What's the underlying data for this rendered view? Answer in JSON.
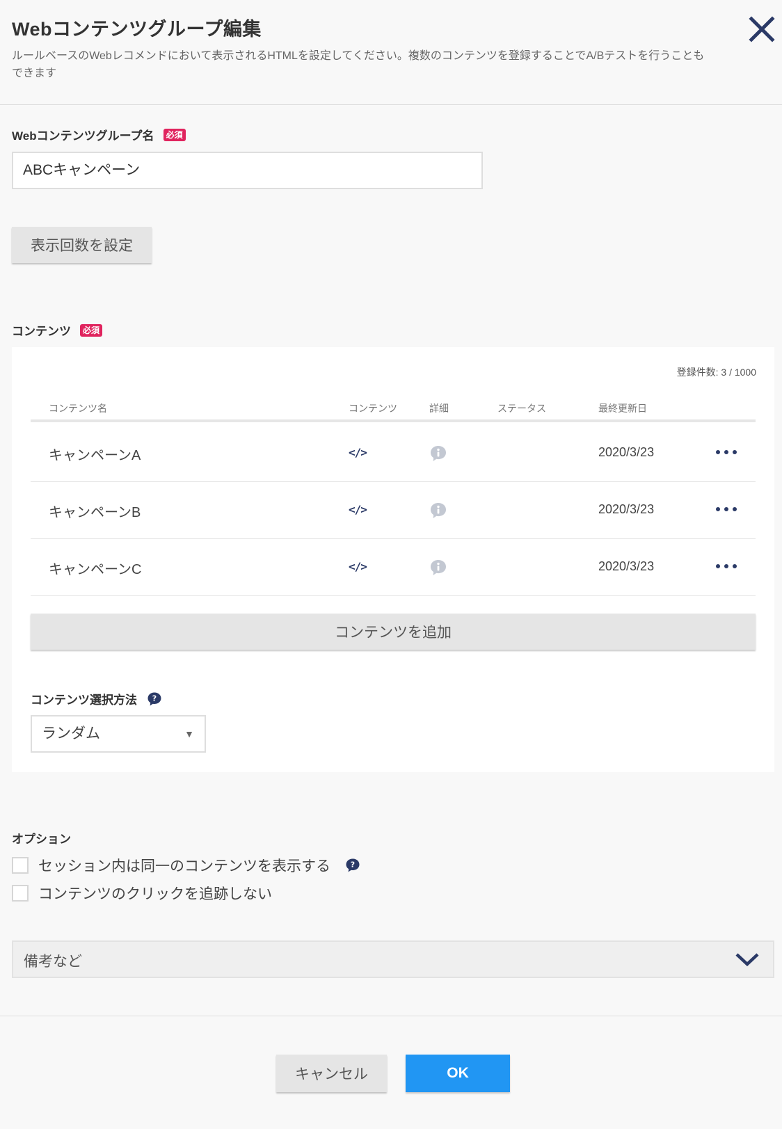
{
  "dialog": {
    "title": "Webコンテンツグループ編集",
    "description": "ルールベースのWebレコメンドにおいて表示されるHTMLを設定してください。複数のコンテンツを登録することでA/Bテストを行うこともできます",
    "close_icon": "close-icon"
  },
  "group_name": {
    "label": "Webコンテンツグループ名",
    "required_badge": "必須",
    "value": "ABCキャンペーン"
  },
  "display_count_button": "表示回数を設定",
  "contents": {
    "label": "コンテンツ",
    "required_badge": "必須",
    "count_text": "登録件数: 3 / 1000",
    "columns": [
      "コンテンツ名",
      "コンテンツ",
      "詳細",
      "ステータス",
      "最終更新日"
    ],
    "rows": [
      {
        "name": "キャンペーンA",
        "code": "</>",
        "status": "",
        "updated": "2020/3/23"
      },
      {
        "name": "キャンペーンB",
        "code": "</>",
        "status": "",
        "updated": "2020/3/23"
      },
      {
        "name": "キャンペーンC",
        "code": "</>",
        "status": "",
        "updated": "2020/3/23"
      }
    ],
    "add_button": "コンテンツを追加",
    "selection": {
      "label": "コンテンツ選択方法",
      "value": "ランダム"
    }
  },
  "options": {
    "label": "オプション",
    "items": [
      {
        "label": "セッション内は同一のコンテンツを表示する",
        "checked": false
      },
      {
        "label": "コンテンツのクリックを追跡しない",
        "checked": false
      }
    ]
  },
  "notes": {
    "label": "備考など"
  },
  "footer": {
    "cancel": "キャンセル",
    "ok": "OK"
  },
  "colors": {
    "accent": "#2196f3",
    "navy": "#2b3a67",
    "required": "#e0245e"
  }
}
